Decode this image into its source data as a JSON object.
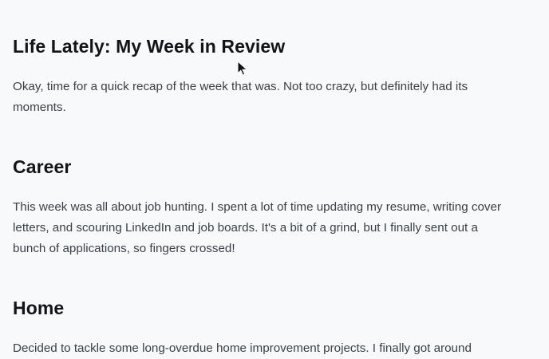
{
  "article": {
    "title": "Life Lately: My Week in Review",
    "intro": "Okay, time for a quick recap of the week that was. Not too crazy, but definitely had its moments.",
    "sections": [
      {
        "heading": "Career",
        "text": "This week was all about job hunting. I spent a lot of time updating my resume, writing cover letters, and scouring LinkedIn and job boards. It's a bit of a grind, but I finally sent out a bunch of applications, so fingers crossed!"
      },
      {
        "heading": "Home",
        "text": "Decided to tackle some long-overdue home improvement projects. I finally got around"
      }
    ]
  },
  "icons": {
    "cursor": "mouse-pointer-icon"
  },
  "colors": {
    "background": "#f8f9fa",
    "heading": "#111418",
    "body": "#3a4047"
  }
}
